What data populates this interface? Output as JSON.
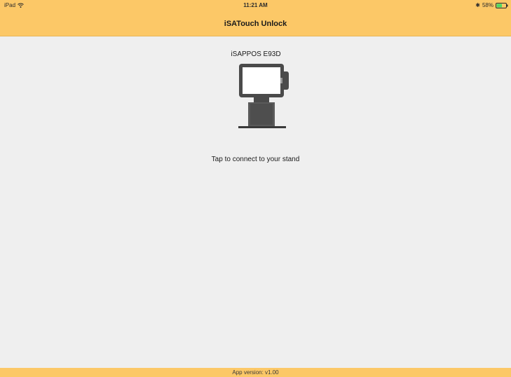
{
  "status_bar": {
    "device": "iPad",
    "time": "11:21 AM",
    "battery_percent": "58%",
    "battery_level": 0.58,
    "icons": [
      "wifi-icon",
      "bluetooth-icon",
      "battery-icon"
    ]
  },
  "nav_bar": {
    "title": "iSATouch Unlock",
    "background_color": "#fcc867"
  },
  "main": {
    "stand": {
      "device_name": "iSAPPOS E93D",
      "illustration": "pos-stand-icon"
    },
    "prompt": "Tap to connect to your stand"
  },
  "footer": {
    "version_text": "App version: v1.00"
  }
}
